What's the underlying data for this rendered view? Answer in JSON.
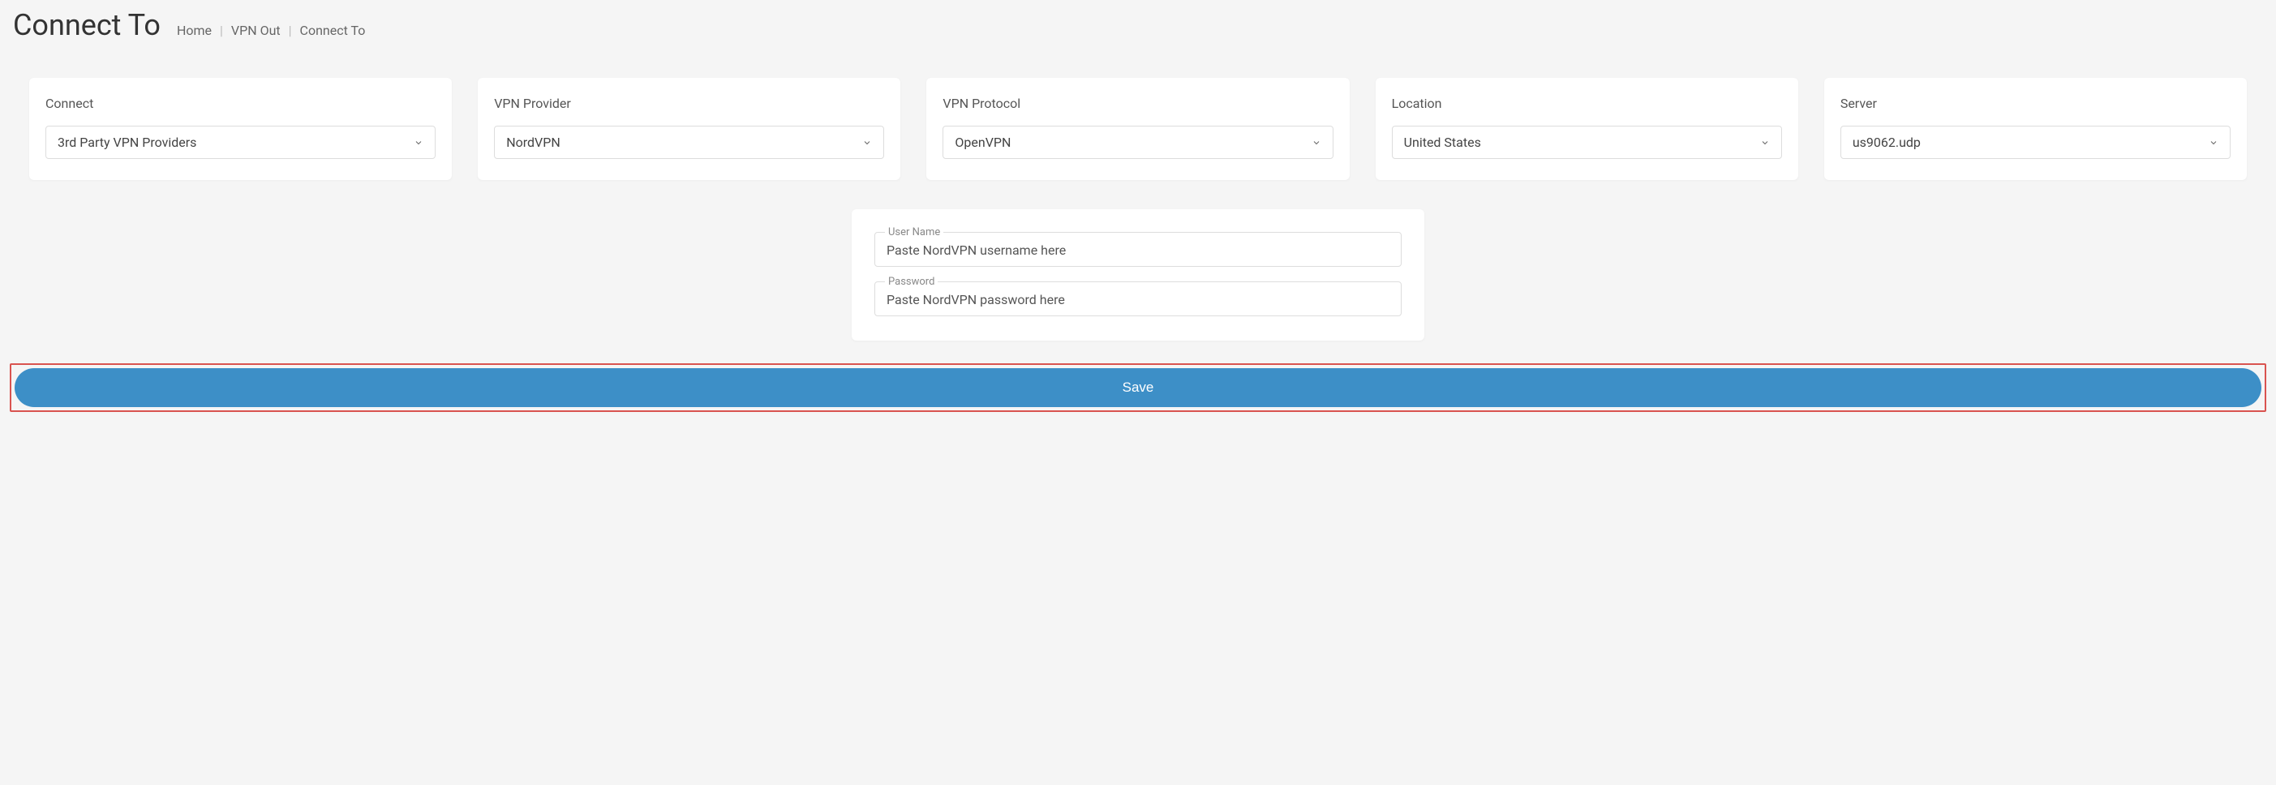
{
  "header": {
    "title": "Connect To",
    "breadcrumb": [
      "Home",
      "VPN Out",
      "Connect To"
    ]
  },
  "cards": {
    "connect": {
      "label": "Connect",
      "value": "3rd Party VPN Providers"
    },
    "provider": {
      "label": "VPN Provider",
      "value": "NordVPN"
    },
    "protocol": {
      "label": "VPN Protocol",
      "value": "OpenVPN"
    },
    "location": {
      "label": "Location",
      "value": "United States"
    },
    "server": {
      "label": "Server",
      "value": "us9062.udp"
    }
  },
  "form": {
    "username": {
      "label": "User Name",
      "placeholder": "Paste NordVPN username here"
    },
    "password": {
      "label": "Password",
      "placeholder": "Paste NordVPN password here"
    }
  },
  "actions": {
    "save": "Save"
  }
}
